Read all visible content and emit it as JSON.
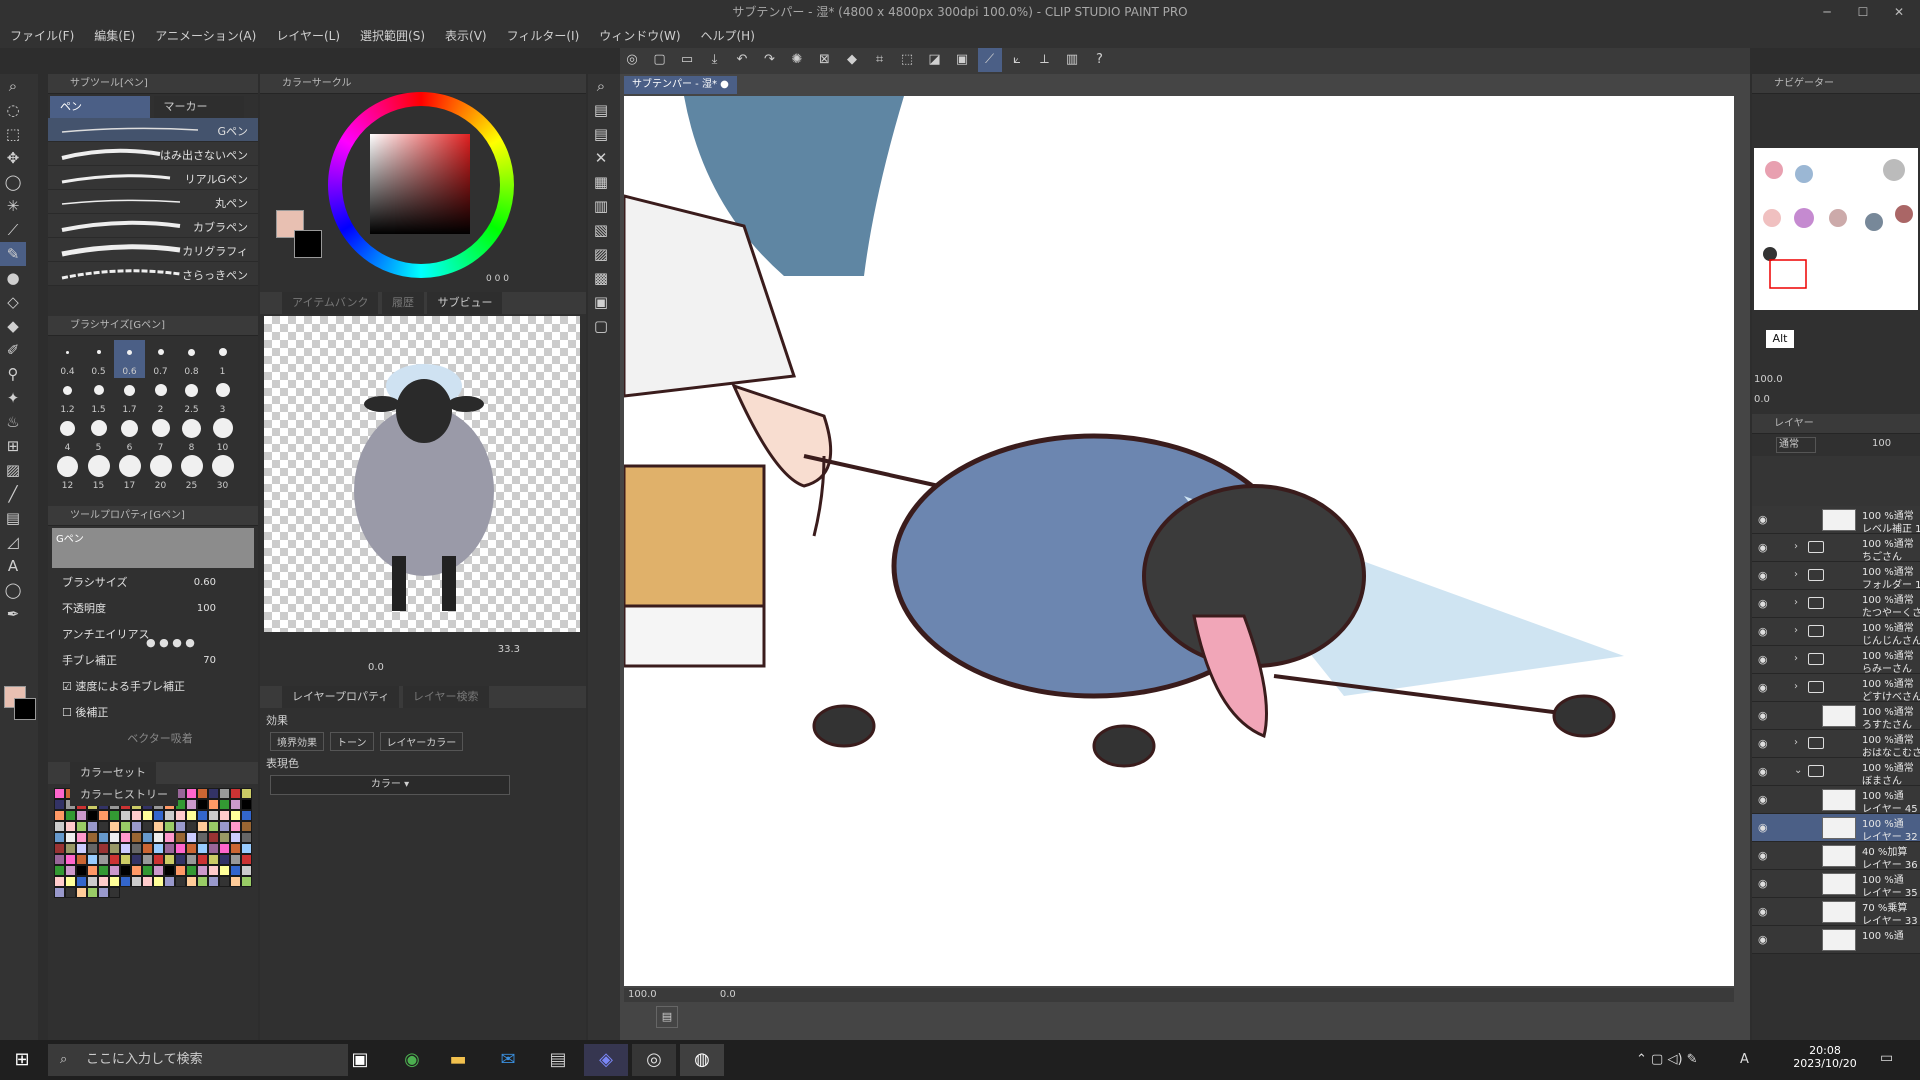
{
  "window": {
    "title": "サブテンパー - 湿* (4800 x 4800px 300dpi 100.0%)  - CLIP STUDIO PAINT PRO",
    "min": "─",
    "max": "☐",
    "close": "✕"
  },
  "menu": [
    "ファイル(F)",
    "編集(E)",
    "アニメーション(A)",
    "レイヤー(L)",
    "選択範囲(S)",
    "表示(V)",
    "フィルター(I)",
    "ウィンドウ(W)",
    "ヘルプ(H)"
  ],
  "subtool": {
    "header": "サブツール[ペン]",
    "tabs": [
      "ペン",
      "マーカー"
    ],
    "brushes": [
      "Gペン",
      "はみ出さないペン",
      "リアルGペン",
      "丸ペン",
      "カブラペン",
      "カリグラフィ",
      "さらっきペン"
    ]
  },
  "brush_size": {
    "header": "ブラシサイズ[Gペン]",
    "sizes": [
      "0.4",
      "0.5",
      "0.6",
      "0.7",
      "0.8",
      "1",
      "1.2",
      "1.5",
      "1.7",
      "2",
      "2.5",
      "3",
      "4",
      "5",
      "6",
      "7",
      "8",
      "10",
      "12",
      "15",
      "17",
      "20",
      "25",
      "30"
    ],
    "selected": "0.6"
  },
  "tool_property": {
    "header": "ツールプロパティ[Gペン]",
    "preview_label": "Gペン",
    "brush_size_label": "ブラシサイズ",
    "brush_size_value": "0.60",
    "opacity_label": "不透明度",
    "opacity_value": "100",
    "antialias_label": "アンチエイリアス",
    "stabilization_label": "手ブレ補正",
    "stabilization_value": "70",
    "speed_label": "速度による手ブレ補正",
    "post_label": "後補正",
    "vector_label": "ベクター吸着"
  },
  "color_palette": {
    "tabs": [
      "カラーセット",
      "カラーヒストリー"
    ]
  },
  "color_wheel": {
    "header": "カラーサークル",
    "hs_values": [
      "0",
      "0",
      "0"
    ]
  },
  "subview": {
    "tabs": [
      "アイテムバンク",
      "履歴",
      "サブビュー"
    ],
    "zoom": "33.3",
    "rotate": "0.0"
  },
  "layer_property": {
    "tabs": [
      "レイヤープロパティ",
      "レイヤー検索"
    ],
    "effect_label": "効果",
    "effects": [
      "境界効果",
      "トーン",
      "レイヤーカラー"
    ],
    "expression_label": "表現色",
    "expression_value": "カラー"
  },
  "canvas_tab": "サブテンパー - 湿*",
  "canvas_status": {
    "zoom": "100.0",
    "rotate": "0.0"
  },
  "navigator": {
    "header": "ナビゲーター",
    "tooltip": "Alt",
    "zoom": "100.0",
    "rotate": "0.0"
  },
  "layer_panel": {
    "header": "レイヤー",
    "blend": "通常",
    "opacity": "100",
    "layers": [
      {
        "l1": "100 %通常",
        "l2": "レベル補正 1",
        "type": "adjust",
        "sel": false
      },
      {
        "l1": "100 %通常",
        "l2": "ちごさん",
        "type": "folder",
        "sel": false
      },
      {
        "l1": "100 %通常",
        "l2": "フォルダー 1",
        "type": "folder",
        "sel": false
      },
      {
        "l1": "100 %通常",
        "l2": "たつやーくさん",
        "type": "folder",
        "sel": false
      },
      {
        "l1": "100 %通常",
        "l2": "じんじんさん",
        "type": "folder",
        "sel": false
      },
      {
        "l1": "100 %通常",
        "l2": "らみーさん",
        "type": "folder",
        "sel": false
      },
      {
        "l1": "100 %通常",
        "l2": "どすけべさん",
        "type": "folder",
        "sel": false
      },
      {
        "l1": "100 %通常",
        "l2": "ろすたさん",
        "type": "layer",
        "sel": false
      },
      {
        "l1": "100 %通常",
        "l2": "おはなこむさん",
        "type": "folder",
        "sel": false
      },
      {
        "l1": "100 %通常",
        "l2": "ぼまさん",
        "type": "folder-open",
        "sel": false
      },
      {
        "l1": "100 %通",
        "l2": "レイヤー 45",
        "type": "layer",
        "sel": false
      },
      {
        "l1": "100 %通",
        "l2": "レイヤー 32",
        "type": "layer",
        "sel": true
      },
      {
        "l1": "40 %加算",
        "l2": "レイヤー 36",
        "type": "layer",
        "sel": false
      },
      {
        "l1": "100 %通",
        "l2": "レイヤー 35",
        "type": "layer",
        "sel": false
      },
      {
        "l1": "70 %乗算",
        "l2": "レイヤー 33",
        "type": "layer",
        "sel": false
      },
      {
        "l1": "100 %通",
        "l2": "",
        "type": "layer",
        "sel": false
      }
    ]
  },
  "taskbar": {
    "search_placeholder": "ここに入力して検索",
    "time": "20:08",
    "date": "2023/10/20",
    "ime": "A"
  },
  "colors": {
    "main": "#e8c0b2",
    "sub": "#000000"
  }
}
